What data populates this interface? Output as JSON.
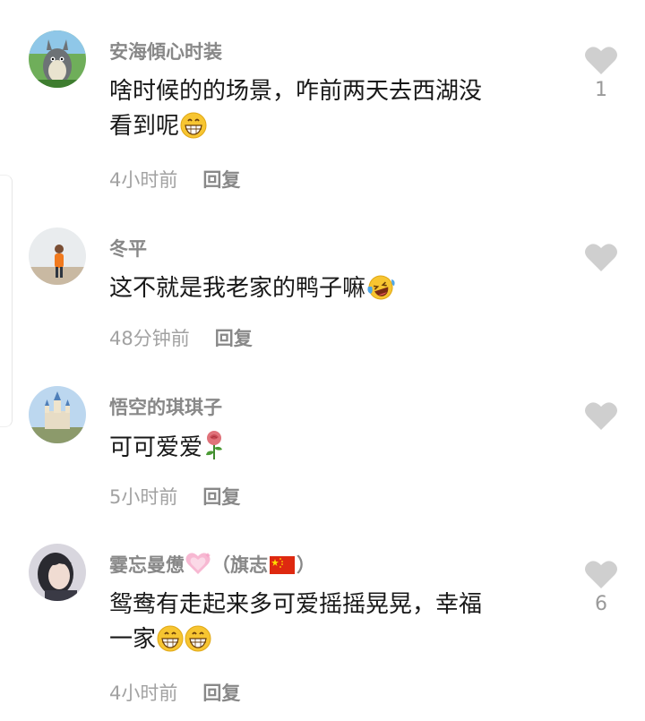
{
  "comments": [
    {
      "username": "安海傾心时装",
      "text": "啥时候的的场景，咋前两天去西湖没\n看到呢",
      "time": "4小时前",
      "reply_label": "回复",
      "likes": "1",
      "emoji": "grin-emoji",
      "avatar": "totoro-avatar"
    },
    {
      "username": "冬平",
      "text": "这不就是我老家的鸭子嘛",
      "time": "48分钟前",
      "reply_label": "回复",
      "likes": "",
      "emoji": "laughing-tears-emoji",
      "avatar": "person-avatar"
    },
    {
      "username": "悟空的琪琪子",
      "text": "可可爱爱",
      "time": "5小时前",
      "reply_label": "回复",
      "likes": "",
      "emoji": "rose-emoji",
      "avatar": "castle-avatar"
    },
    {
      "username": "霎忘曼憊",
      "username_suffix": "（旗志",
      "username_close": "）",
      "text": "鸳鸯有走起来多可爱摇摇晃晃，幸福\n一家",
      "time": "4小时前",
      "reply_label": "回复",
      "likes": "6",
      "emoji": "grin-emoji",
      "avatar": "girl-avatar"
    }
  ],
  "colors": {
    "name": "#888888",
    "time": "#a2a2a2",
    "heart": "#cfcfcf",
    "text": "#181818"
  }
}
